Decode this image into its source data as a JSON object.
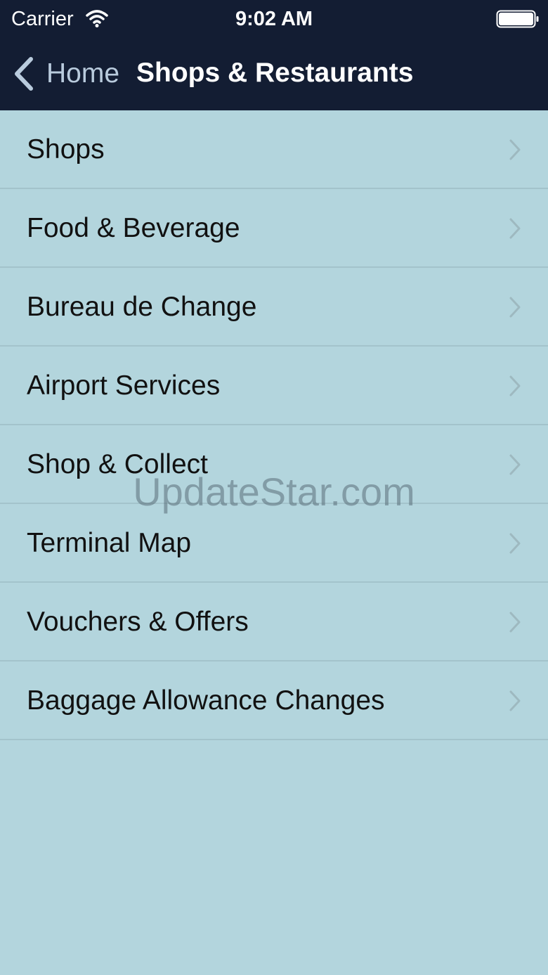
{
  "status_bar": {
    "carrier": "Carrier",
    "time": "9:02 AM",
    "icons": [
      "wifi-icon",
      "battery-icon"
    ]
  },
  "nav_bar": {
    "back_label": "Home",
    "title": "Shops & Restaurants",
    "back_icon": "chevron-left-icon"
  },
  "menu": {
    "items": [
      {
        "label": "Shops"
      },
      {
        "label": "Food & Beverage"
      },
      {
        "label": "Bureau de Change"
      },
      {
        "label": "Airport Services"
      },
      {
        "label": "Shop & Collect"
      },
      {
        "label": "Terminal Map"
      },
      {
        "label": "Vouchers & Offers"
      },
      {
        "label": "Baggage Allowance Changes"
      }
    ],
    "disclosure_icon": "chevron-right-icon"
  },
  "watermark": "UpdateStar.com",
  "colors": {
    "bar_background": "#131d33",
    "list_background": "#b3d5dd",
    "back_tint": "#b9cbdd",
    "separator": "#a3c3cb"
  }
}
